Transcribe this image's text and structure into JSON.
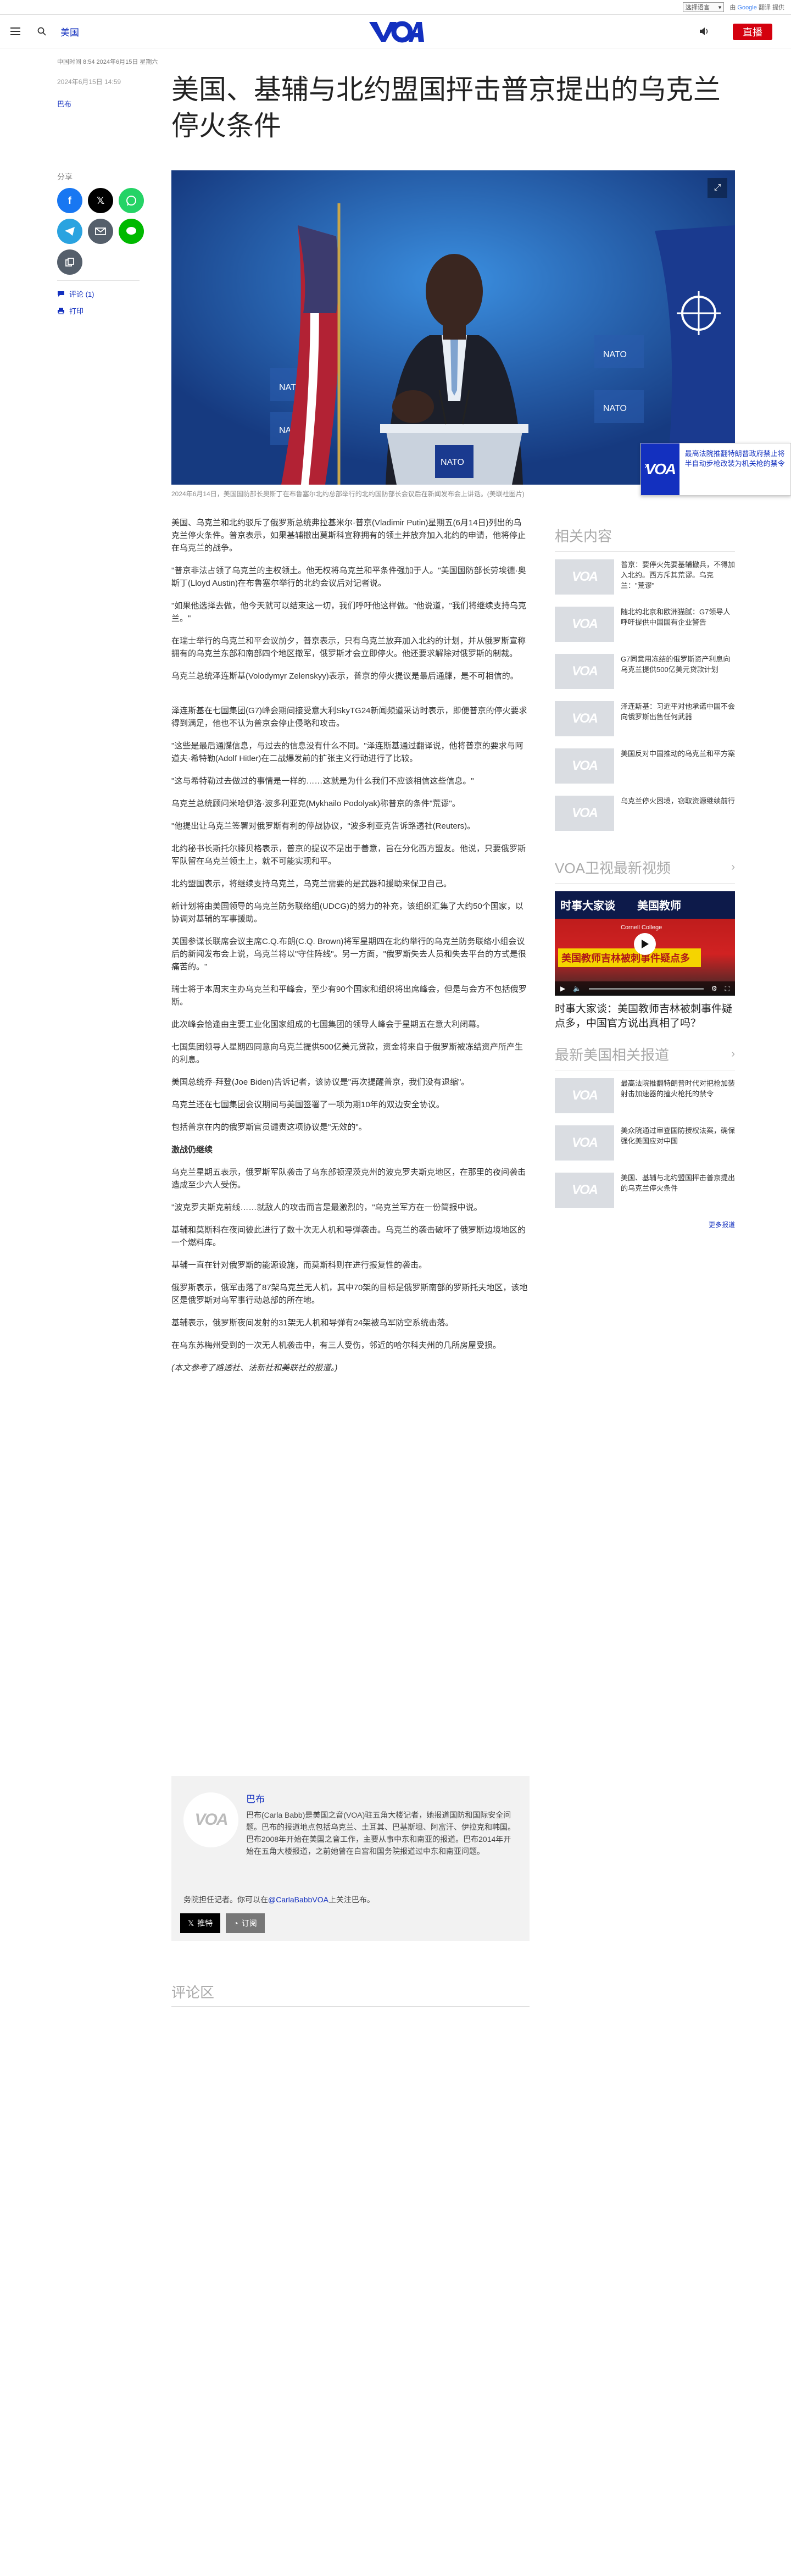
{
  "langbar": {
    "select_label": "选择语言",
    "google": "Google",
    "translate": "翻译",
    "powered": "由",
    "powered_suffix": "提供"
  },
  "header": {
    "section": "美国",
    "live_label": "直播"
  },
  "updated": "中国时间 8:54 2024年6月15日 星期六",
  "article": {
    "date": "2024年6月15日 14:59",
    "author": "巴布",
    "title": "美国、基辅与北约盟国抨击普京提出的乌克兰停火条件",
    "caption": "2024年6月14日，美国国防部长奥斯丁在布鲁塞尔北约总部举行的北约国防部长会议后在新闻发布会上讲话。(美联社图片)",
    "paragraphs": [
      "美国、乌克兰和北约驳斥了俄罗斯总统弗拉基米尔·普京(Vladimir Putin)星期五(6月14日)列出的乌克兰停火条件。普京表示，如果基辅撤出莫斯科宣称拥有的领土并放弃加入北约的申请，他将停止在乌克兰的战争。",
      "\"普京非法占领了乌克兰的主权领土。他无权将乌克兰和平条件强加于人。\"美国国防部长劳埃德·奥斯丁(Lloyd Austin)在布鲁塞尔举行的北约会议后对记者说。",
      "\"如果他选择去做，他今天就可以结束这一切，我们呼吁他这样做。\"他说道，\"我们将继续支持乌克兰。\"",
      "在瑞士举行的乌克兰和平会议前夕，普京表示，只有乌克兰放弃加入北约的计划，并从俄罗斯宣称拥有的乌克兰东部和南部四个地区撤军，俄罗斯才会立即停火。他还要求解除对俄罗斯的制裁。",
      "乌克兰总统泽连斯基(Volodymyr Zelenskyy)表示，普京的停火提议是最后通牒，是不可相信的。",
      "泽连斯基在七国集团(G7)峰会期间接受意大利SkyTG24新闻频道采访时表示，即便普京的停火要求得到满足，他也不认为普京会停止侵略和攻击。",
      "\"这些是最后通牒信息，与过去的信息没有什么不同。\"泽连斯基通过翻译说，他将普京的要求与阿道夫·希特勒(Adolf Hitler)在二战爆发前的扩张主义行动进行了比较。",
      "\"这与希特勒过去做过的事情是一样的……这就是为什么我们不应该相信这些信息。\"",
      "乌克兰总统顾问米哈伊洛·波多利亚克(Mykhailo Podolyak)称普京的条件\"荒谬\"。",
      "\"他提出让乌克兰签署对俄罗斯有利的停战协议，\"波多利亚克告诉路透社(Reuters)。",
      "北约秘书长斯托尔滕贝格表示，普京的提议不是出于善意，旨在分化西方盟友。他说，只要俄罗斯军队留在乌克兰领土上，就不可能实现和平。",
      "北约盟国表示，将继续支持乌克兰，乌克兰需要的是武器和援助来保卫自己。",
      "新计划将由美国领导的乌克兰防务联络组(UDCG)的努力的补充，该组织汇集了大约50个国家，以协调对基辅的军事援助。",
      "美国参谋长联席会议主席C.Q.布朗(C.Q. Brown)将军星期四在北约举行的乌克兰防务联络小组会议后的新闻发布会上说，乌克兰将以\"守住阵线\"。另一方面，\"俄罗斯失去人员和失去平台的方式是很痛苦的。\"",
      "瑞士将于本周末主办乌克兰和平峰会，至少有90个国家和组织将出席峰会，但是与会方不包括俄罗斯。",
      "此次峰会恰逢由主要工业化国家组成的七国集团的领导人峰会于星期五在意大利闭幕。",
      "七国集团领导人星期四同意向乌克兰提供500亿美元贷款，资金将来自于俄罗斯被冻结资产所产生的利息。",
      "美国总统乔·拜登(Joe Biden)告诉记者，该协议是\"再次提醒普京，我们没有退缩\"。",
      "乌克兰还在七国集团会议期间与美国签署了一项为期10年的双边安全协议。",
      "包括普京在内的俄罗斯官员谴责这项协议是\"无效的\"。"
    ],
    "subheading": "激战仍继续",
    "paragraphs2": [
      "乌克兰星期五表示，俄罗斯军队袭击了乌东部顿涅茨克州的波克罗夫斯克地区，在那里的夜间袭击造成至少六人受伤。",
      "\"波克罗夫斯克前线……就敌人的攻击而言是最激烈的，\"乌克兰军方在一份简报中说。",
      "基辅和莫斯科在夜间彼此进行了数十次无人机和导弹袭击。乌克兰的袭击破坏了俄罗斯边境地区的一个燃料库。",
      "基辅一直在针对俄罗斯的能源设施，而莫斯科则在进行报复性的袭击。",
      "俄罗斯表示，俄军击落了87架乌克兰无人机，其中70架的目标是俄罗斯南部的罗斯托夫地区，该地区是俄罗斯对乌军事行动总部的所在地。",
      "基辅表示，俄罗斯夜间发射的31架无人机和导弹有24架被乌军防空系统击落。",
      "在乌东苏梅州受到的一次无人机袭击中，有三人受伤，邻近的哈尔科夫州的几所房屋受损。"
    ],
    "note": "(本文参考了路透社、法新社和美联社的报道。)"
  },
  "share": {
    "label": "分享",
    "comments": "评论 (1)",
    "print": "打印"
  },
  "floater": {
    "text": "最高法院推翻特朗普政府禁止将半自动步枪改装为机关枪的禁令"
  },
  "author_box": {
    "name": "巴布",
    "bio": "巴布(Carla Babb)是美国之音(VOA)驻五角大楼记者，她报道国防和国际安全问题。巴布的报道地点包括乌克兰、土耳其、巴基斯坦、阿富汗、伊拉克和韩国。巴布2008年开始在美国之音工作，主要从事中东和南亚的报道。巴布2014年开始在五角大楼报道，之前她曾在白宫和国务院报道过中东和南亚问题。",
    "bio_tail": "务院担任记者。你可以在",
    "handle": "@CarlaBabbVOA",
    "bio_end": "上关注巴布。",
    "follow_label": "推特",
    "subscribe_label": "订阅"
  },
  "comments_heading": "评论区",
  "sidebar": {
    "related_heading": "相关内容",
    "related": [
      "普京：要停火先要基辅撤兵，不得加入北约。西方斥其荒谬。乌克兰：\"荒谬\"",
      "随北约北京和欧洲猫腻：G7领导人呼吁提供中国国有企业警告",
      "G7同意用冻结的俄罗斯资产利息向乌克兰提供500亿美元贷款计划",
      "泽连斯基：习近平对他承诺中国不会向俄罗斯出售任何武器",
      "美国反对中国推动的乌克兰和平方案",
      "乌克兰停火困境，窃取资源继续前行"
    ],
    "video_heading": "VOA卫视最新视频",
    "video_banner": "时事大家谈：美国教师吉林被刺事件疑点多，中国官方说出真相了吗？",
    "video_overlay_title": "时事大家谈",
    "video_overlay_sub": "美国教师",
    "video_red_text": "美国教师吉林被刺事件疑点多",
    "video_source": "Cornell College",
    "latest_heading": "最新美国相关报道",
    "latest": [
      "最高法院推翻特朗普时代对把枪加装射击加速器的撞火枪托的禁令",
      "美众院通过审查国防授权法案，确保强化美国应对中国",
      "美国、基辅与北约盟国抨击普京提出的乌克兰停火条件"
    ],
    "more": "更多报道"
  },
  "colors": {
    "accent": "#1330bf",
    "live": "#d4000e",
    "facebook": "#1877f2",
    "x": "#000000",
    "whatsapp": "#25d366",
    "telegram": "#2aa3e0",
    "email": "#555f6b",
    "line": "#00b900",
    "copy": "#555f6b"
  }
}
